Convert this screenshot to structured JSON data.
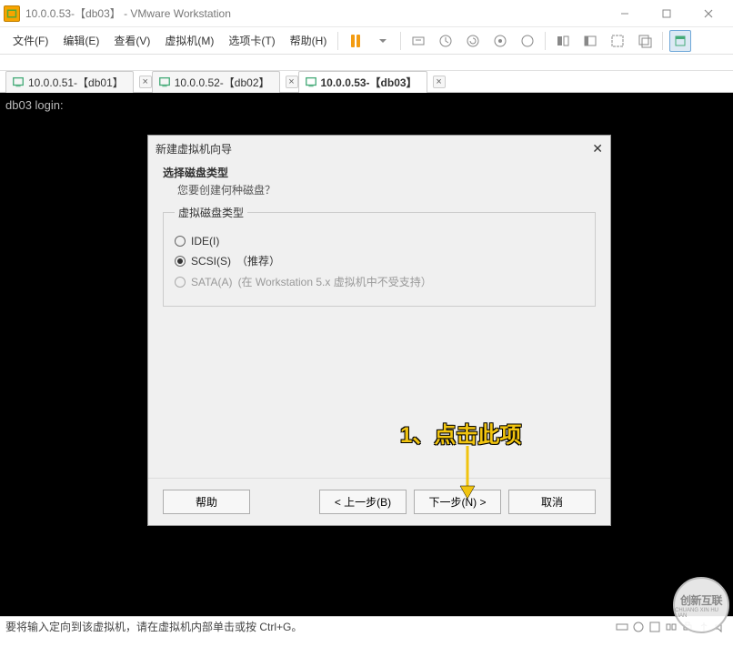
{
  "title": "10.0.0.53-【db03】 - VMware Workstation",
  "menu": {
    "file": "文件(F)",
    "edit": "编辑(E)",
    "view": "查看(V)",
    "vm": "虚拟机(M)",
    "tabs": "选项卡(T)",
    "help": "帮助(H)"
  },
  "tabs": [
    {
      "label": "10.0.0.51-【db01】",
      "active": false
    },
    {
      "label": "10.0.0.52-【db02】",
      "active": false
    },
    {
      "label": "10.0.0.53-【db03】",
      "active": true
    }
  ],
  "console": {
    "prompt": "db03 login:"
  },
  "dialog": {
    "title": "新建虚拟机向导",
    "heading": "选择磁盘类型",
    "sub": "您要创建何种磁盘？",
    "group": "虚拟磁盘类型",
    "opts": {
      "ide": "IDE(I)",
      "scsi": "SCSI(S)",
      "scsi_note": "（推荐）",
      "sata": "SATA(A)",
      "sata_note": "(在 Workstation 5.x 虚拟机中不受支持）"
    },
    "btns": {
      "help": "帮助",
      "back": "< 上一步(B)",
      "next": "下一步(N) >",
      "cancel": "取消"
    }
  },
  "annotation": "1、点击此项",
  "statusbar": "要将输入定向到该虚拟机，请在虚拟机内部单击或按 Ctrl+G。",
  "watermark": {
    "big": "创新互联",
    "small": "CHUANG XIN HU LIAN"
  }
}
